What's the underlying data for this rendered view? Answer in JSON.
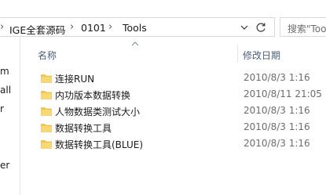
{
  "address": {
    "crumbs": [
      "IGE全套源码",
      "0101",
      "Tools"
    ],
    "separator": "›"
  },
  "search": {
    "placeholder": "搜索\"Too"
  },
  "navpane": {
    "items": [
      "m",
      "all",
      "r",
      "er"
    ]
  },
  "columns": {
    "name": "名称",
    "modified": "修改日期"
  },
  "files": [
    {
      "name": "连接RUN",
      "modified": "2010/8/3 1:16"
    },
    {
      "name": "内功版本数据转换",
      "modified": "2010/8/11 21:05"
    },
    {
      "name": "人物数据类测试大小",
      "modified": "2010/8/3 1:16"
    },
    {
      "name": "数据转换工具",
      "modified": "2010/8/3 1:16"
    },
    {
      "name": "数据转换工具(BLUE)",
      "modified": "2010/8/3 1:16"
    }
  ],
  "colors": {
    "folder": "#f3c74f",
    "header_text": "#4c607a"
  }
}
